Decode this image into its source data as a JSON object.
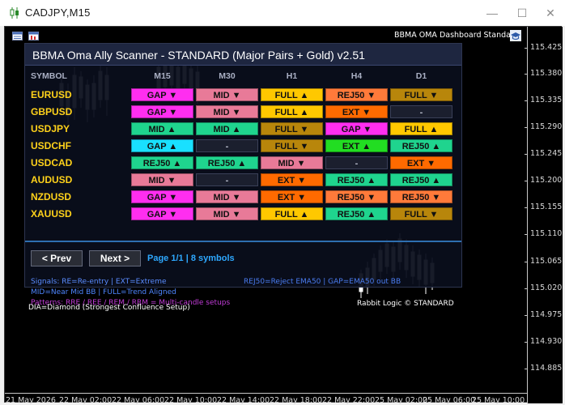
{
  "window": {
    "title": "CADJPY,M15",
    "icon": "candlestick-icon",
    "buttons": [
      "minimize-icon",
      "maximize-icon",
      "close-icon"
    ]
  },
  "chart": {
    "top_label": "BBMA OMA Dashboard Standard",
    "toolbar_icons": [
      "template-icon",
      "indicator-icon"
    ],
    "price_labels": [
      "115.425",
      "115.380",
      "115.335",
      "115.290",
      "115.245",
      "115.200",
      "115.155",
      "115.110",
      "115.065",
      "115.020",
      "114.975",
      "114.930",
      "114.885"
    ],
    "time_labels": [
      "21 May 2026",
      "22 May 02:00",
      "22 May 06:00",
      "22 May 10:00",
      "22 May 14:00",
      "22 May 18:00",
      "22 May 22:00",
      "25 May 02:00",
      "25 May 06:00",
      "25 May 10:00"
    ]
  },
  "dashboard": {
    "title": "BBMA Oma Ally Scanner - STANDARD (Major Pairs + Gold) v2.51",
    "columns": [
      "SYMBOL",
      "M15",
      "M30",
      "H1",
      "H4",
      "D1"
    ],
    "rows": [
      {
        "symbol": "EURUSD",
        "cells": [
          {
            "t": "GAP ▼",
            "c": "#ff2ef0"
          },
          {
            "t": "MID ▼",
            "c": "#e87a98"
          },
          {
            "t": "FULL ▲",
            "c": "#ffc800"
          },
          {
            "t": "REJ50 ▼",
            "c": "#ff7a3a"
          },
          {
            "t": "FULL ▼",
            "c": "#b8860b"
          }
        ]
      },
      {
        "symbol": "GBPUSD",
        "cells": [
          {
            "t": "GAP ▼",
            "c": "#ff2ef0"
          },
          {
            "t": "MID ▼",
            "c": "#e87a98"
          },
          {
            "t": "FULL ▲",
            "c": "#ffc800"
          },
          {
            "t": "EXT ▼",
            "c": "#ff6a00"
          },
          {
            "t": "-",
            "c": ""
          }
        ]
      },
      {
        "symbol": "USDJPY",
        "cells": [
          {
            "t": "MID ▲",
            "c": "#1fd48e"
          },
          {
            "t": "MID ▲",
            "c": "#1fd48e"
          },
          {
            "t": "FULL ▼",
            "c": "#b8860b"
          },
          {
            "t": "GAP ▼",
            "c": "#ff2ef0"
          },
          {
            "t": "FULL ▲",
            "c": "#ffc800"
          }
        ]
      },
      {
        "symbol": "USDCHF",
        "cells": [
          {
            "t": "GAP ▲",
            "c": "#19e0ff"
          },
          {
            "t": "-",
            "c": ""
          },
          {
            "t": "FULL ▼",
            "c": "#b8860b"
          },
          {
            "t": "EXT ▲",
            "c": "#22dd22"
          },
          {
            "t": "REJ50 ▲",
            "c": "#1fd48e"
          }
        ]
      },
      {
        "symbol": "USDCAD",
        "cells": [
          {
            "t": "REJ50 ▲",
            "c": "#1fd48e"
          },
          {
            "t": "REJ50 ▲",
            "c": "#1fd48e"
          },
          {
            "t": "MID ▼",
            "c": "#e87a98"
          },
          {
            "t": "-",
            "c": ""
          },
          {
            "t": "EXT ▼",
            "c": "#ff6a00"
          }
        ]
      },
      {
        "symbol": "AUDUSD",
        "cells": [
          {
            "t": "MID ▼",
            "c": "#e87a98"
          },
          {
            "t": "-",
            "c": ""
          },
          {
            "t": "EXT ▼",
            "c": "#ff6a00"
          },
          {
            "t": "REJ50 ▲",
            "c": "#1fd48e"
          },
          {
            "t": "REJ50 ▲",
            "c": "#1fd48e"
          }
        ]
      },
      {
        "symbol": "NZDUSD",
        "cells": [
          {
            "t": "GAP ▼",
            "c": "#ff2ef0"
          },
          {
            "t": "MID ▼",
            "c": "#e87a98"
          },
          {
            "t": "EXT ▼",
            "c": "#ff6a00"
          },
          {
            "t": "REJ50 ▼",
            "c": "#ff7a3a"
          },
          {
            "t": "REJ50 ▼",
            "c": "#ff7a3a"
          }
        ]
      },
      {
        "symbol": "XAUUSD",
        "cells": [
          {
            "t": "GAP ▼",
            "c": "#ff2ef0"
          },
          {
            "t": "MID ▼",
            "c": "#e87a98"
          },
          {
            "t": "FULL ▲",
            "c": "#ffc800"
          },
          {
            "t": "REJ50 ▲",
            "c": "#1fd48e"
          },
          {
            "t": "FULL ▼",
            "c": "#b8860b"
          }
        ]
      }
    ],
    "prev_label": "< Prev",
    "next_label": "Next >",
    "page_info": "Page 1/1 | 8 symbols",
    "legend": {
      "signals": "Signals: RE=Re-entry | EXT=Extreme",
      "rej_gap": "REJ50=Reject EMA50 | GAP=EMA50 out BB",
      "mid_full": "MID=Near Mid BB | FULL=Trend Aligned",
      "patterns": "Patterns: RRE / REE / REM / RRM = Multi-candle setups",
      "dia": "DIA=Diamond (Strongest Confluence Setup)",
      "credit": "Rabbit Logic © STANDARD"
    },
    "colors": {
      "signals": "#5a8cff",
      "rej_gap": "#4a7cf0",
      "mid_full": "#4e86ff",
      "patterns": "#c23cd8",
      "dia": "#ffffff",
      "credit": "#ffffff"
    }
  }
}
